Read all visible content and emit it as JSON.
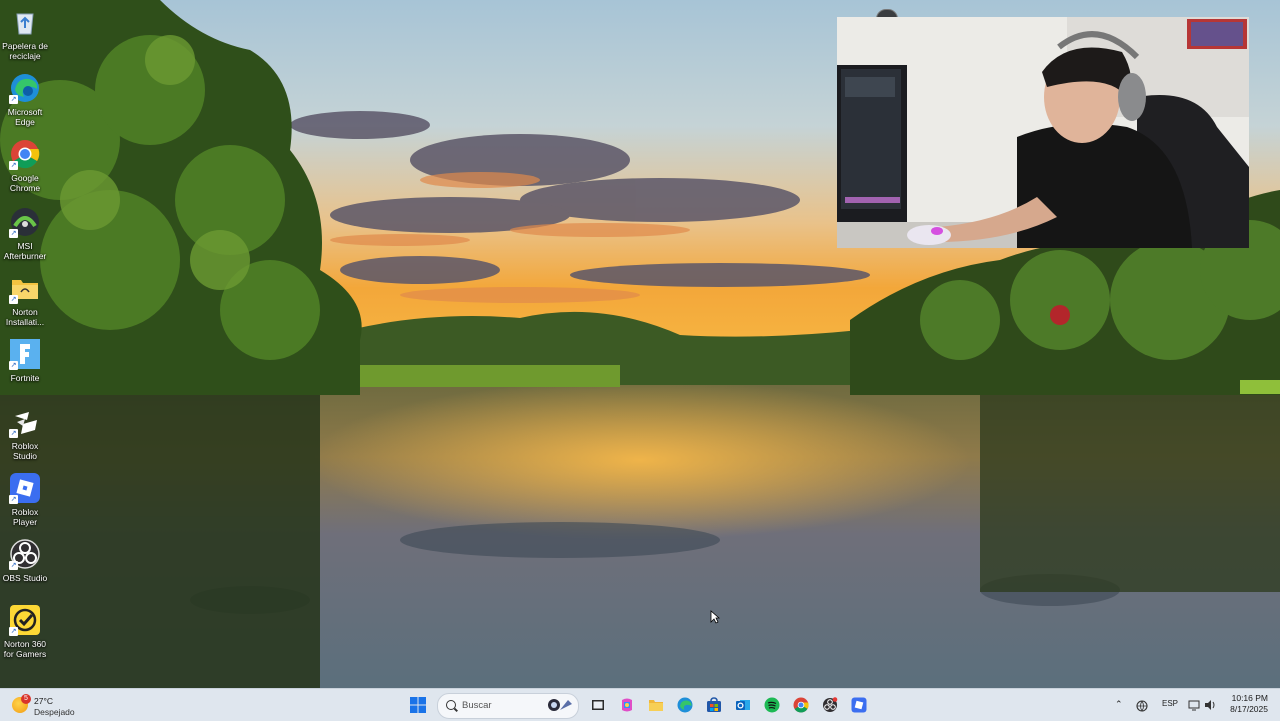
{
  "desktop": {
    "icons": [
      {
        "label": "Papelera de reciclaje",
        "icon": "recycle-bin-icon"
      },
      {
        "label": "Microsoft Edge",
        "icon": "edge-icon"
      },
      {
        "label": "Google Chrome",
        "icon": "chrome-icon"
      },
      {
        "label": "MSI Afterburner",
        "icon": "afterburner-icon"
      },
      {
        "label": "Norton Installati...",
        "icon": "folder-icon"
      },
      {
        "label": "Fortnite",
        "icon": "fortnite-icon"
      },
      {
        "label": "Roblox Studio",
        "icon": "roblox-studio-icon"
      },
      {
        "label": "Roblox Player",
        "icon": "roblox-player-icon"
      },
      {
        "label": "OBS Studio",
        "icon": "obs-icon"
      },
      {
        "label": "Norton 360 for Gamers",
        "icon": "norton-icon"
      }
    ]
  },
  "taskbar": {
    "weather": {
      "temp": "27°C",
      "condition": "Despejado",
      "badge": "5"
    },
    "search_placeholder": "Buscar",
    "pinned": [
      "start-icon",
      "task-view-icon",
      "copilot-icon",
      "file-explorer-icon",
      "edge-icon",
      "store-icon",
      "outlook-icon",
      "spotify-icon",
      "chrome-icon",
      "obs-icon",
      "roblox-icon"
    ],
    "tray": {
      "language": "ESP"
    },
    "clock": {
      "time": "10:16 PM",
      "date": "8/17/2025"
    }
  },
  "colors": {
    "taskbar_bg": "#dfe6ee",
    "sky_top": "#a9c7da",
    "sunset": "#f5a623"
  }
}
